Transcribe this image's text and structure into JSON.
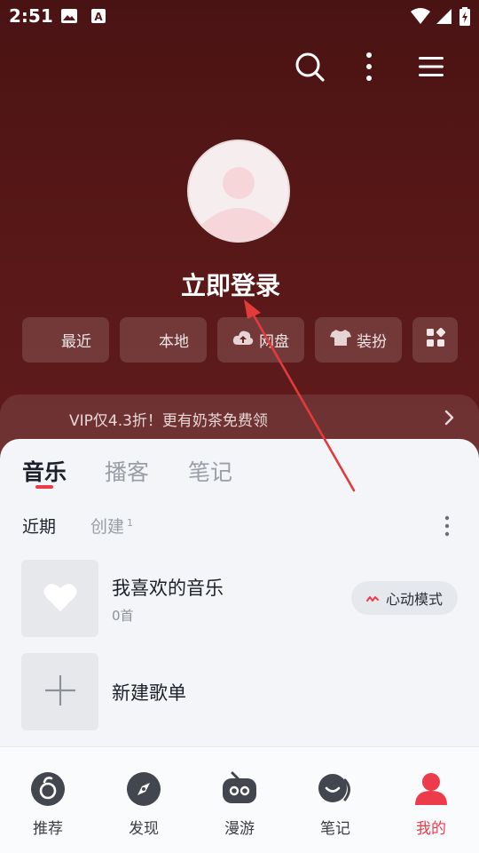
{
  "status_bar": {
    "time": "2:51"
  },
  "header": {
    "login_label": "立即登录"
  },
  "shortcuts": [
    {
      "label": "最近",
      "icon": "clock-icon"
    },
    {
      "label": "本地",
      "icon": "folder-icon"
    },
    {
      "label": "网盘",
      "icon": "cloud-upload-icon"
    },
    {
      "label": "装扮",
      "icon": "shirt-icon"
    },
    {
      "label": "",
      "icon": "apps-grid-icon"
    }
  ],
  "vip_banner": {
    "text": "VIP仅4.3折！更有奶茶免费领"
  },
  "tabs": [
    {
      "label": "音乐",
      "active": true
    },
    {
      "label": "播客",
      "active": false
    },
    {
      "label": "笔记",
      "active": false
    }
  ],
  "subtabs": {
    "recent": "近期",
    "created": "创建",
    "created_count": "1"
  },
  "playlists": [
    {
      "name": "我喜欢的音乐",
      "count": "0首",
      "icon": "heart-icon"
    },
    {
      "name": "新建歌单",
      "icon": "plus-icon"
    }
  ],
  "heart_mode_label": "心动模式",
  "nav": [
    {
      "label": "推荐",
      "icon": "netease-logo-icon",
      "active": false
    },
    {
      "label": "发现",
      "icon": "compass-icon",
      "active": false
    },
    {
      "label": "漫游",
      "icon": "radio-icon",
      "active": false
    },
    {
      "label": "笔记",
      "icon": "notes-face-icon",
      "active": false
    },
    {
      "label": "我的",
      "icon": "user-icon",
      "active": true
    }
  ],
  "colors": {
    "accent": "#ee3b4c",
    "header_bg": "#561616",
    "sheet_bg": "#f3f5f8"
  }
}
